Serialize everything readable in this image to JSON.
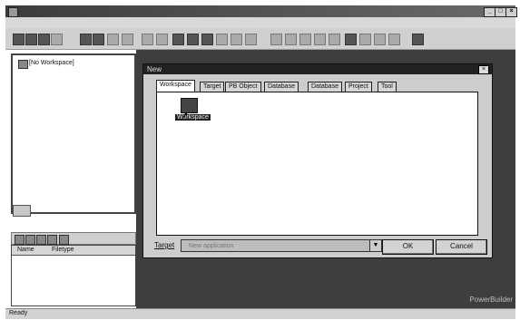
{
  "window": {
    "title": "",
    "min_label": "_",
    "max_label": "□",
    "close_label": "×"
  },
  "menu": {
    "items": [
      "",
      "",
      "",
      "",
      ""
    ]
  },
  "tree": {
    "root_label": "[No Workspace]"
  },
  "lower_pane": {
    "columns": [
      "Name",
      "Filetype"
    ]
  },
  "dialog": {
    "title": "New",
    "close_label": "×",
    "tabs": [
      "Workspace",
      "Target",
      "PB Object",
      "Database",
      "Database",
      "Project",
      "Tool"
    ],
    "active_tab": "Workspace",
    "item_label": "Workspace",
    "target_label": "Target",
    "target_placeholder": "New application",
    "ok_label": "OK",
    "cancel_label": "Cancel"
  },
  "status": {
    "text": "Ready"
  },
  "watermark": "PowerBuilder"
}
